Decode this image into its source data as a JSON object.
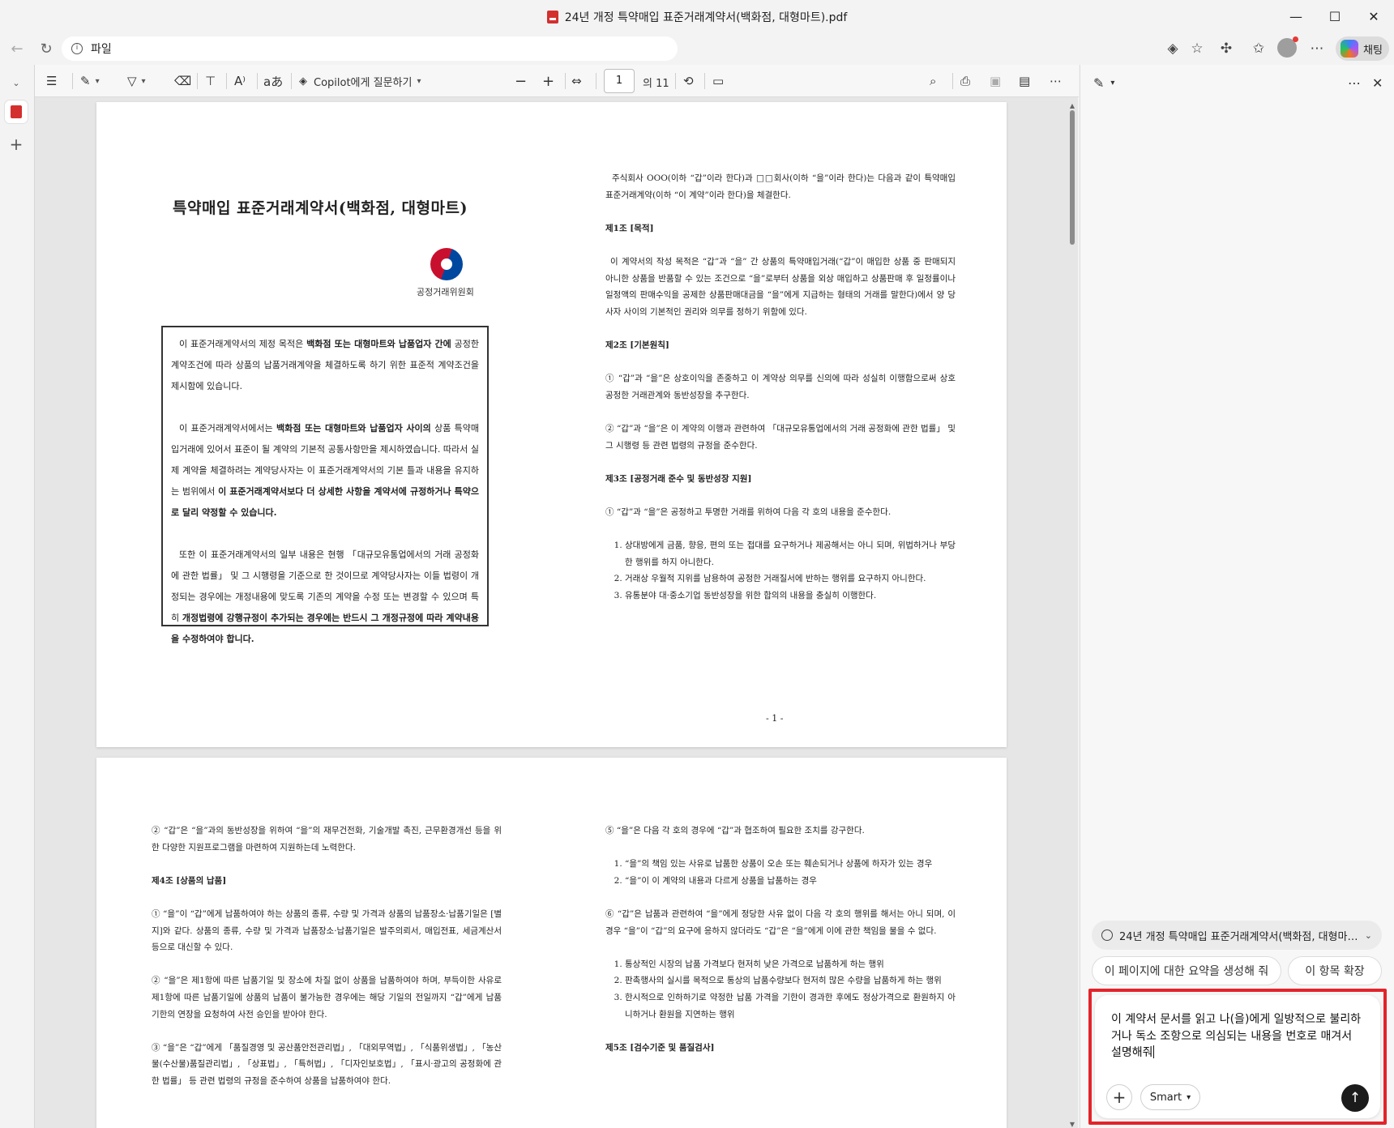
{
  "window": {
    "title": "24년 개정 특약매입 표준거래계약서(백화점, 대형마트).pdf",
    "controls": [
      "—",
      "☐",
      "✕"
    ]
  },
  "addressbar": {
    "url": "파일",
    "copilot_label": "채팅"
  },
  "pdf_toolbar": {
    "copilot_label": "Copilot에게 질문하기",
    "page_current": "1",
    "page_total": "의 11",
    "icons": [
      "contents-icon",
      "highlight-icon",
      "draw-icon",
      "eraser-icon",
      "textbox-icon",
      "read-aloud-icon",
      "translate-icon",
      "zoom-out-icon",
      "zoom-in-icon",
      "fit-width-icon",
      "rotate-icon",
      "page-view-icon",
      "search-icon",
      "print-icon",
      "save-icon",
      "save-as-icon",
      "more-icon"
    ]
  },
  "page1": {
    "title": "특약매입 표준거래계약서(백화점, 대형마트)",
    "seal_name": "공정거래위원회",
    "page_number": "- 1 -",
    "notice": {
      "p1_a": "이 표준거래계약서의 제정 목적은 ",
      "p1_b": "백화점 또는 대형마트와 납품업자 간에",
      "p1_c": " 공정한 계약조건에 따라 상품의 납품거래계약을 체결하도록 하기 위한 표준적 계약조건을 제시함에 있습니다.",
      "p2_a": "이 표준거래계약서에서는 ",
      "p2_b": "백화점 또는 대형마트와 납품업자 사이의",
      "p2_c": " 상품 특약매입거래에 있어서 표준이 될 계약의 기본적 공통사항만을 제시하였습니다. 따라서 실제 계약을 체결하려는 계약당사자는 이 표준거래계약서의 기본 틀과 내용을 유지하는 범위에서 ",
      "p2_d": "이 표준거래계약서보다 더 상세한 사항을 계약서에 규정하거나 특약으로 달리 약정할 수 있습니다.",
      "p3_a": "또한 이 표준거래계약서의 일부 내용은 현행 「대규모유통업에서의 거래 공정화에 관한 법률」 및 그 시행령을 기준으로 한 것이므로 계약당사자는 이들 법령이 개정되는 경우에는 개정내용에 맞도록 기존의 계약을 수정 또는 변경할 수 있으며 특히 ",
      "p3_b": "개정법령에 강행규정이 추가되는 경우에는 반드시 그 개정규정에 따라 계약내용을 수정하여야 합니다."
    },
    "right": {
      "intro": "주식회사 OOO(이하 “갑”이라 한다)과 □□회사(이하 “을”이라 한다)는 다음과 같이 특약매입 표준거래계약(이하 “이 계약”이라 한다)을 체결한다.",
      "art1": "제1조 [목적]",
      "art1_body": "이 계약서의 작성 목적은 “갑”과 “을” 간 상품의 특약매입거래(“갑”이 매입한 상품 중 판매되지 아니한 상품을 반품할 수 있는 조건으로 “을”로부터 상품을 외상 매입하고 상품판매 후 일정률이나 일정액의 판매수익을 공제한 상품판매대금을 “을”에게 지급하는 형태의 거래를 말한다)에서 양 당사자 사이의 기본적인 권리와 의무를 정하기 위함에 있다.",
      "art2": "제2조 [기본원칙]",
      "art2_1": "① “갑”과 “을”은 상호이익을 존중하고 이 계약상 의무를 신의에 따라 성실히 이행함으로써 상호 공정한 거래관계와 동반성장을 추구한다.",
      "art2_2": "② “갑”과 “을”은 이 계약의 이행과 관련하여 「대규모유통업에서의 거래 공정화에 관한 법률」 및 그 시행령 등 관련 법령의 규정을 준수한다.",
      "art3": "제3조 [공정거래 준수 및 동반성장 지원]",
      "art3_1": "① “갑”과 “을”은 공정하고 투명한 거래를 위하여 다음 각 호의 내용을 준수한다.",
      "art3_items": [
        "상대방에게 금품, 향응, 편의 또는 접대를 요구하거나 제공해서는 아니 되며, 위법하거나 부당한 행위를 하지 아니한다.",
        "거래상 우월적 지위를 남용하여 공정한 거래질서에 반하는 행위를 요구하지 아니한다.",
        "유통분야 대·중소기업 동반성장을 위한 합의의 내용을 충실히 이행한다."
      ]
    }
  },
  "page2": {
    "left": {
      "p1": "② “갑”은 “을”과의 동반성장을 위하여 “을”의 재무건전화, 기술개발 촉진, 근무환경개선 등을 위한 다양한 지원프로그램을 마련하여 지원하는데 노력한다.",
      "art4": "제4조 [상품의 납품]",
      "p2": "① “을”이 “갑”에게 납품하여야 하는 상품의 종류, 수량 및 가격과 상품의 납품장소·납품기일은 [별지]와 같다. 상품의 종류, 수량 및 가격과 납품장소·납품기일은 발주의뢰서, 매입전표, 세금계산서 등으로 대신할 수 있다.",
      "p3": "② “을”은 제1항에 따른 납품기일 및 장소에 차질 없이 상품을 납품하여야 하며, 부득이한 사유로 제1항에 따른 납품기일에 상품의 납품이 불가능한 경우에는 해당 기일의 전일까지 “갑”에게 납품 기한의 연장을 요청하여 사전 승인을 받아야 한다.",
      "p4": "③ “을”은 “갑”에게 「품질경영 및 공산품안전관리법」, 「대외무역법」, 「식품위생법」, 「농산물(수산물)품질관리법」, 「상표법」, 「특허법」, 「디자인보호법」, 「표시·광고의 공정화에 관한 법률」 등 관련 법령의 규정을 준수하여 상품을 납품하여야 한다."
    },
    "right": {
      "p1": "⑤ “을”은 다음 각 호의 경우에 “갑”과 협조하여 필요한 조치를 강구한다.",
      "items1": [
        "“을”의 책임 있는 사유로 납품한 상품이 오손 또는 훼손되거나 상품에 하자가 있는 경우",
        "“을”이 이 계약의 내용과 다르게 상품을 납품하는 경우"
      ],
      "p2": "⑥ “갑”은 납품과 관련하여 “을”에게 정당한 사유 없이 다음 각 호의 행위를 해서는 아니 되며, 이 경우 “을”이 “갑”의 요구에 응하지 않더라도 “갑”은 “을”에게 이에 관한 책임을 물을 수 없다.",
      "items2": [
        "통상적인 시장의 납품 가격보다 현저히 낮은 가격으로 납품하게 하는 행위",
        "판촉행사의 실시를 목적으로 통상의 납품수량보다 현저히 많은 수량을 납품하게 하는 행위",
        "한시적으로 인하하기로 약정한 납품 가격을 기한이 경과한 후에도 정상가격으로 환원하지 아니하거나 환원을 지연하는 행위"
      ],
      "art5": "제5조 [검수기준 및 품질검사]"
    }
  },
  "copilot_pane": {
    "context_chip": "24년 개정 특약매입 표준거래계약서(백화점, 대형마트).pdf",
    "suggestions": [
      "이 페이지에 대한 요약을 생성해 줘",
      "이 항목 확장"
    ],
    "prompt": "이 계약서 문서를 읽고 나(을)에게 일방적으로 불리하거나 독소 조항으로 의심되는 내용을 번호로 매겨서 설명해줘",
    "mode": "Smart",
    "highlight_color": "#e3242b"
  }
}
